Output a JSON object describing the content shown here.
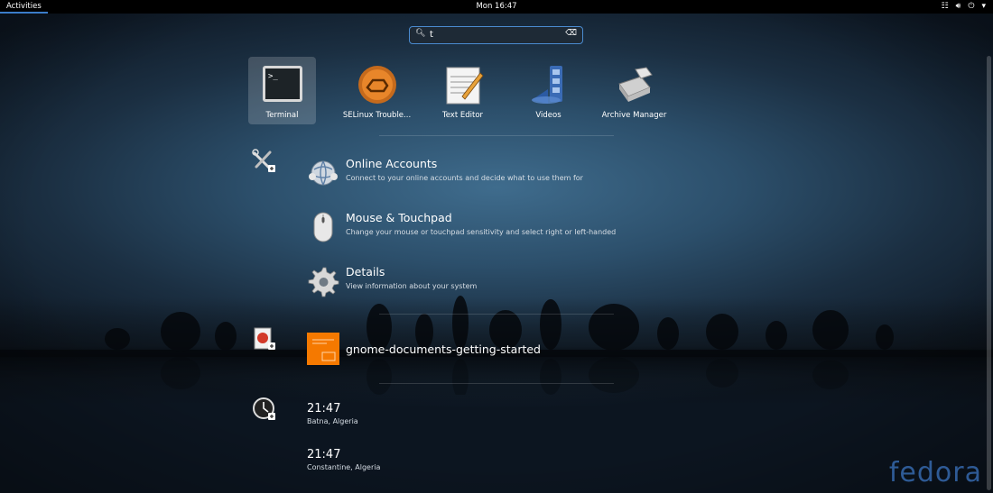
{
  "topbar": {
    "activities": "Activities",
    "clock": "Mon 16:47"
  },
  "search": {
    "value": "t"
  },
  "apps": [
    {
      "label": "Terminal",
      "icon": "terminal-icon"
    },
    {
      "label": "SELinux Trouble...",
      "icon": "selinux-icon"
    },
    {
      "label": "Text Editor",
      "icon": "text-editor-icon"
    },
    {
      "label": "Videos",
      "icon": "videos-icon"
    },
    {
      "label": "Archive Manager",
      "icon": "archive-manager-icon"
    }
  ],
  "settings_results": [
    {
      "title": "Online Accounts",
      "desc": "Connect to your online accounts and decide what to use them for",
      "icon": "online-accounts-icon"
    },
    {
      "title": "Mouse & Touchpad",
      "desc": "Change your mouse or touchpad sensitivity and select right or left-handed",
      "icon": "mouse-icon"
    },
    {
      "title": "Details",
      "desc": "View information about your system",
      "icon": "gear-icon"
    }
  ],
  "documents_results": [
    {
      "title": "gnome-documents-getting-started",
      "icon": "document-icon"
    }
  ],
  "clock_results": [
    {
      "time": "21:47",
      "city": "Batna, Algeria"
    },
    {
      "time": "21:47",
      "city": "Constantine, Algeria"
    }
  ],
  "branding": "fedora",
  "colors": {
    "accent": "#3b7cc9",
    "doc_orange": "#f57900"
  }
}
